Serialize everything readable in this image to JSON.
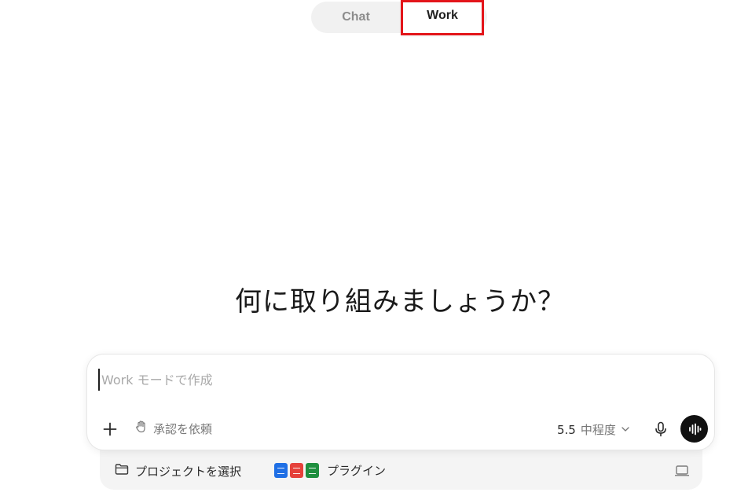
{
  "mode_toggle": {
    "chat_label": "Chat",
    "work_label": "Work",
    "active": "Work"
  },
  "heading": "何に取り組みましょうか？",
  "composer": {
    "placeholder": "Work モードで作成",
    "approval_label": "承認を依頼",
    "model_version": "5.5",
    "model_level": "中程度"
  },
  "footer": {
    "project_label": "プロジェクトを選択",
    "plugins_label": "プラグイン"
  },
  "icons": {
    "add": "plus-icon",
    "approval": "hand-icon",
    "chevron": "chevron-down-icon",
    "mic": "microphone-icon",
    "voice": "voice-waveform-icon",
    "folder": "folder-icon",
    "plugins": [
      "doc-icon",
      "pdf-icon",
      "sheet-icon"
    ],
    "device": "laptop-icon"
  },
  "colors": {
    "highlight_border": "#e3151a",
    "voice_button": "#111111",
    "toggle_background": "#f1f1f1"
  }
}
